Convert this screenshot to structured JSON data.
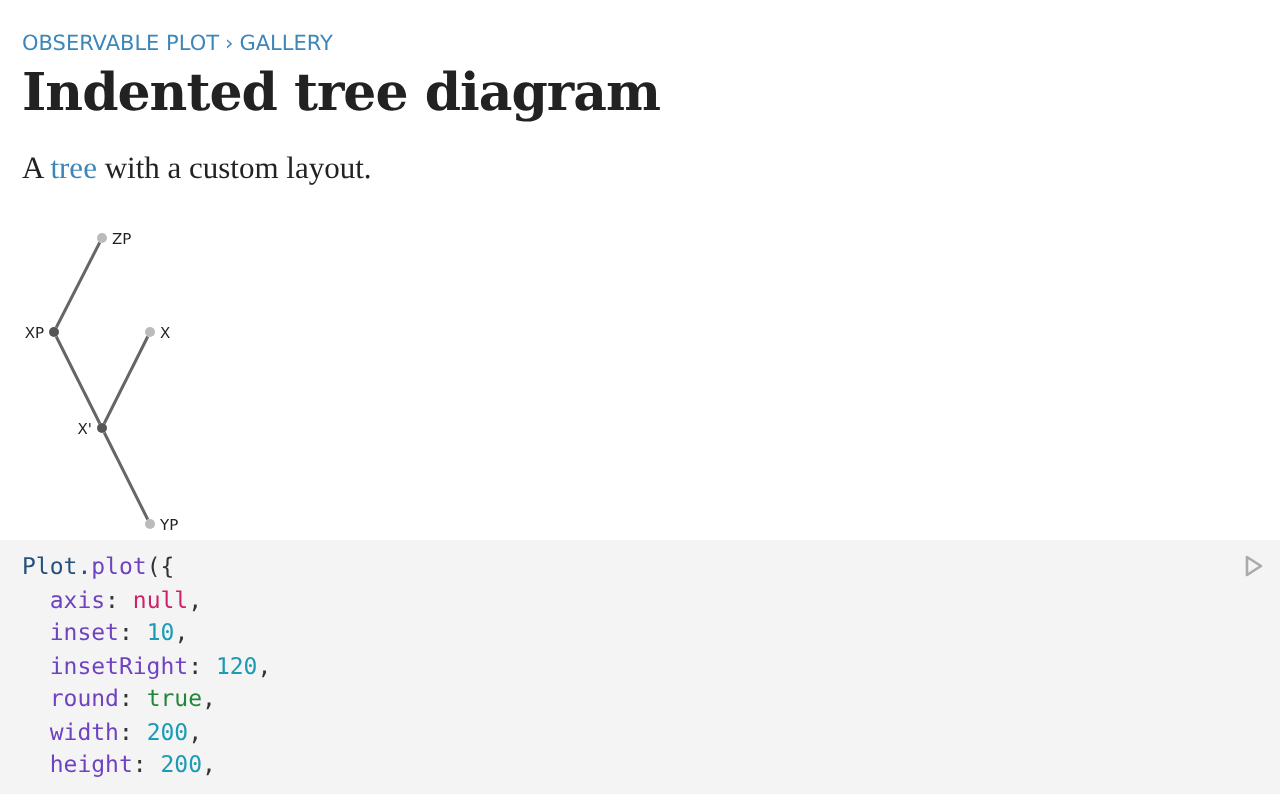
{
  "breadcrumb": {
    "items": [
      "OBSERVABLE PLOT",
      "GALLERY"
    ],
    "separator": "›"
  },
  "title": "Indented tree diagram",
  "intro": [
    {
      "kind": "text",
      "text": "A "
    },
    {
      "kind": "link",
      "text": "tree"
    },
    {
      "kind": "text",
      "text": " with a custom layout."
    }
  ],
  "tree": {
    "label": "XP",
    "children": [
      {
        "label": "ZP"
      },
      {
        "label": "X'",
        "children": [
          {
            "label": "X"
          },
          {
            "label": "YP"
          }
        ]
      }
    ]
  },
  "code": [
    [
      {
        "kind": "fn",
        "text": "Plot."
      },
      {
        "kind": "method",
        "text": "plot"
      },
      {
        "kind": "punct",
        "text": "({"
      }
    ],
    [
      {
        "kind": "prop",
        "text": "  axis"
      },
      {
        "kind": "punct",
        "text": ": "
      },
      {
        "kind": "null",
        "text": "null"
      },
      {
        "kind": "punct",
        "text": ","
      }
    ],
    [
      {
        "kind": "prop",
        "text": "  inset"
      },
      {
        "kind": "punct",
        "text": ": "
      },
      {
        "kind": "number",
        "text": "10"
      },
      {
        "kind": "punct",
        "text": ","
      }
    ],
    [
      {
        "kind": "prop",
        "text": "  insetRight"
      },
      {
        "kind": "punct",
        "text": ": "
      },
      {
        "kind": "number",
        "text": "120"
      },
      {
        "kind": "punct",
        "text": ","
      }
    ],
    [
      {
        "kind": "prop",
        "text": "  round"
      },
      {
        "kind": "punct",
        "text": ": "
      },
      {
        "kind": "bool",
        "text": "true"
      },
      {
        "kind": "punct",
        "text": ","
      }
    ],
    [
      {
        "kind": "prop",
        "text": "  width"
      },
      {
        "kind": "punct",
        "text": ": "
      },
      {
        "kind": "number",
        "text": "200"
      },
      {
        "kind": "punct",
        "text": ","
      }
    ],
    [
      {
        "kind": "prop",
        "text": "  height"
      },
      {
        "kind": "punct",
        "text": ": "
      },
      {
        "kind": "number",
        "text": "200"
      },
      {
        "kind": "punct",
        "text": ","
      }
    ]
  ]
}
